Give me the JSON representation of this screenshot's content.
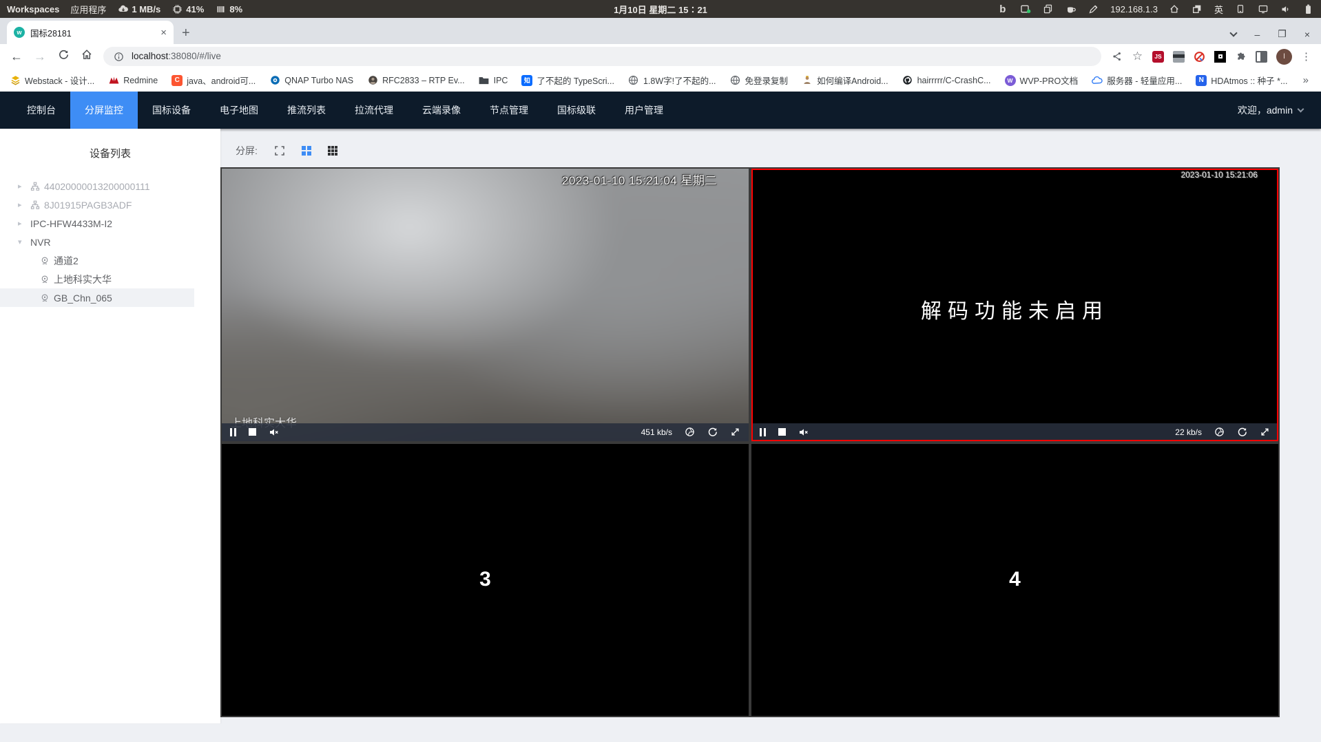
{
  "system_bar": {
    "workspaces_label": "Workspaces",
    "applications_label": "应用程序",
    "net_speed": "1 MB/s",
    "cpu_percent": "41%",
    "mem_percent": "8%",
    "clock": "1月10日 星期二 15∶21",
    "bing_glyph": "b",
    "ip_address": "192.168.1.3",
    "input_method": "英"
  },
  "browser": {
    "tab_title": "国标28181",
    "new_tab_glyph": "+",
    "close_glyph": "×",
    "url": {
      "host": "localhost",
      "rest": ":38080/#/live"
    },
    "js_badge": "JS",
    "profile_initial": "I",
    "bookmarks": [
      {
        "label": "Webstack - 设计..."
      },
      {
        "label": "Redmine"
      },
      {
        "label": "java、android可...",
        "glyph": "C"
      },
      {
        "label": "QNAP Turbo NAS"
      },
      {
        "label": "RFC2833 – RTP Ev..."
      },
      {
        "label": "IPC"
      },
      {
        "label": "了不起的 TypeScri...",
        "glyph": "知"
      },
      {
        "label": "1.8W字!了不起的..."
      },
      {
        "label": "免登录复制"
      },
      {
        "label": "如何编译Android..."
      },
      {
        "label": "hairrrrr/C-CrashC..."
      },
      {
        "label": "WVP-PRO文档",
        "glyph": "W"
      },
      {
        "label": "服务器 - 轻量应用..."
      },
      {
        "label": "HDAtmos :: 种子 *...",
        "glyph": "N"
      }
    ],
    "bookmarks_overflow": "»"
  },
  "nav": {
    "items": [
      "控制台",
      "分屏监控",
      "国标设备",
      "电子地图",
      "推流列表",
      "拉流代理",
      "云端录像",
      "节点管理",
      "国标级联",
      "用户管理"
    ],
    "active_item": "分屏监控",
    "welcome": "欢迎，admin"
  },
  "sidebar": {
    "title": "设备列表",
    "tree": [
      {
        "label": "44020000013200000111"
      },
      {
        "label": "8J01915PAGB3ADF"
      },
      {
        "label": "IPC-HFW4433M-I2"
      },
      {
        "label": "NVR"
      },
      {
        "label": "通道2"
      },
      {
        "label": "上地科实大华"
      },
      {
        "label": "GB_Chn_065"
      }
    ]
  },
  "toolbar": {
    "split_label": "分屏:"
  },
  "players": {
    "p1": {
      "osd_time": "2023-01-10 15:21:04 星期二",
      "name": "上地科实大华",
      "bitrate": "451 kb/s"
    },
    "p2": {
      "osd_time": "2023-01-10 15:21:06",
      "message": "解码功能未启用",
      "bitrate": "22 kb/s"
    },
    "p3": {
      "number": "3"
    },
    "p4": {
      "number": "4"
    }
  },
  "colors": {
    "accent_blue": "#3e8df5",
    "selected_red": "#ff0000",
    "nav_bg": "#0d1b2a"
  }
}
